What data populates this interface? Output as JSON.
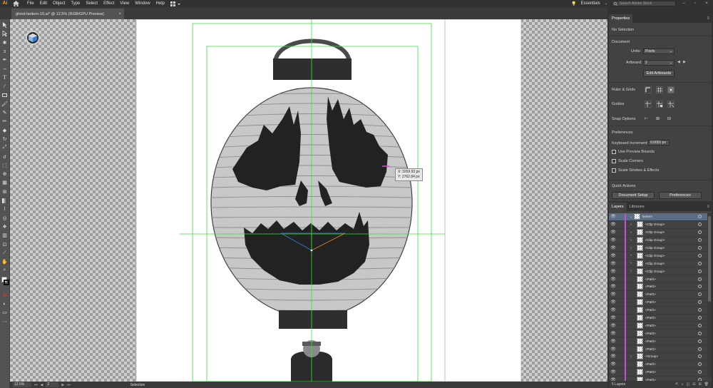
{
  "app": {
    "logo": "Ai",
    "menus": [
      "File",
      "Edit",
      "Object",
      "Type",
      "Select",
      "Effect",
      "View",
      "Window",
      "Help"
    ],
    "workspace": "Essentials",
    "search_placeholder": "Search Adobe Stock"
  },
  "document": {
    "tab_title": "ghost-lantern-10.ai* @ 12.5% (RGB/GPU Preview)",
    "close_glyph": "×"
  },
  "canvas": {
    "cursor_readout_x": "X: 3269.93 px",
    "cursor_readout_y": "Y: 2762.84 px"
  },
  "status": {
    "zoom": "12.5%",
    "artboard": "2",
    "tool": "Selection"
  },
  "properties": {
    "tab_label": "Properties",
    "selection": "No Selection",
    "document_heading": "Document",
    "units_label": "Units:",
    "units_value": "Pixels",
    "artboard_label": "Artboard:",
    "artboard_value": "2",
    "edit_artboards": "Edit Artboards",
    "ruler_grids": "Ruler & Grids",
    "guides": "Guides",
    "snap_options": "Snap Options",
    "preferences_heading": "Preferences",
    "keyboard_increment_label": "Keyboard Increment:",
    "keyboard_increment_value": "0.0001 px",
    "use_preview_bounds": "Use Preview Bounds",
    "scale_corners": "Scale Corners",
    "scale_strokes": "Scale Strokes & Effects",
    "quick_actions": "Quick Actions",
    "document_setup": "Document Setup",
    "preferences_button": "Preferences"
  },
  "layers_panel": {
    "tab_layers": "Layers",
    "tab_libraries": "Libraries",
    "count_label": "5 Layers",
    "rows": [
      {
        "name": "lantern",
        "arrow": "⌄",
        "selected": true,
        "indent": 0
      },
      {
        "name": "<Clip Group>",
        "arrow": "›",
        "indent": 1
      },
      {
        "name": "<Clip Group>",
        "arrow": "›",
        "indent": 1
      },
      {
        "name": "<Clip Group>",
        "arrow": "›",
        "indent": 1
      },
      {
        "name": "<Clip Group>",
        "arrow": "›",
        "indent": 1
      },
      {
        "name": "<Clip Group>",
        "arrow": "›",
        "indent": 1
      },
      {
        "name": "<Clip Group>",
        "arrow": "›",
        "indent": 1
      },
      {
        "name": "<Clip Group>",
        "arrow": "›",
        "indent": 1
      },
      {
        "name": "<Path>",
        "arrow": "",
        "indent": 1
      },
      {
        "name": "<Path>",
        "arrow": "",
        "indent": 1
      },
      {
        "name": "<Path>",
        "arrow": "",
        "indent": 1
      },
      {
        "name": "<Path>",
        "arrow": "",
        "indent": 1
      },
      {
        "name": "<Path>",
        "arrow": "",
        "indent": 1
      },
      {
        "name": "<Path>",
        "arrow": "",
        "indent": 1
      },
      {
        "name": "<Path>",
        "arrow": "",
        "indent": 1
      },
      {
        "name": "<Path>",
        "arrow": "",
        "indent": 1
      },
      {
        "name": "<Path>",
        "arrow": "",
        "indent": 1
      },
      {
        "name": "<Path>",
        "arrow": "",
        "indent": 1
      },
      {
        "name": "<Group>",
        "arrow": "›",
        "indent": 1
      },
      {
        "name": "<Path>",
        "arrow": "",
        "indent": 1
      },
      {
        "name": "<Path>",
        "arrow": "",
        "indent": 1
      },
      {
        "name": "<Path>",
        "arrow": "",
        "indent": 1
      }
    ]
  },
  "colors": {
    "layer_color": "#c54fd4",
    "guide_color": "#3ddc3d",
    "selection_highlight": "#5a6c86"
  }
}
